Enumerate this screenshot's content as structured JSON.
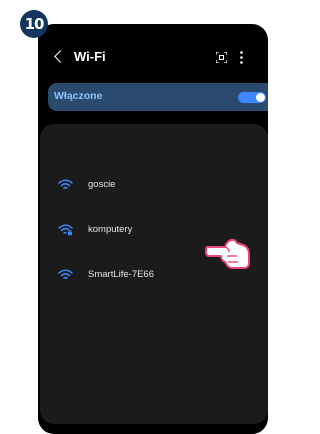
{
  "step_badge": "10",
  "header": {
    "title": "Wi-Fi"
  },
  "toggle": {
    "label": "Włączone",
    "state": "on",
    "accent": "#3e86ff"
  },
  "networks": [
    {
      "name": "goscie",
      "secured": false
    },
    {
      "name": "komputery",
      "secured": true
    },
    {
      "name": "SmartLife-7E66",
      "secured": false
    }
  ],
  "colors": {
    "wifi_icon": "#3e86ff",
    "toggle_row_bg": "#2b4b6e",
    "step_badge_bg": "#14355e"
  }
}
